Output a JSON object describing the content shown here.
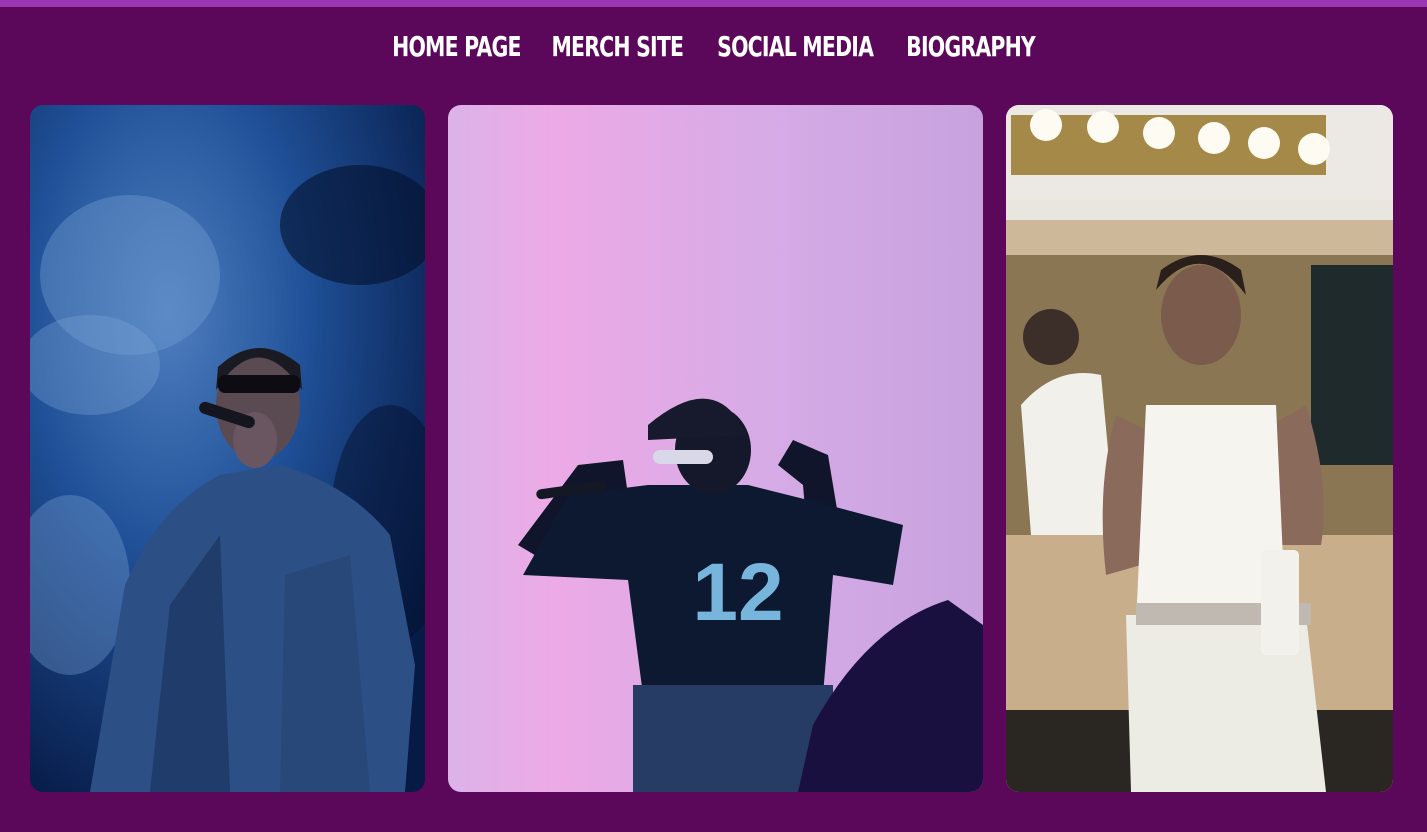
{
  "nav": {
    "items": [
      {
        "label": "HOME PAGE"
      },
      {
        "label": "MERCH SITE"
      },
      {
        "label": "SOCIAL MEDIA"
      },
      {
        "label": "BIOGRAPHY"
      }
    ]
  },
  "gallery": {
    "photos": [
      {
        "name": "performer-blue-smoke-photo",
        "jersey": ""
      },
      {
        "name": "performer-pink-backdrop-photo",
        "jersey": "12"
      },
      {
        "name": "backstage-mirror-photo",
        "jersey": ""
      }
    ]
  },
  "colors": {
    "background": "#5b075a",
    "top_strip": "#9b35b3",
    "nav_text": "#ffffff"
  }
}
